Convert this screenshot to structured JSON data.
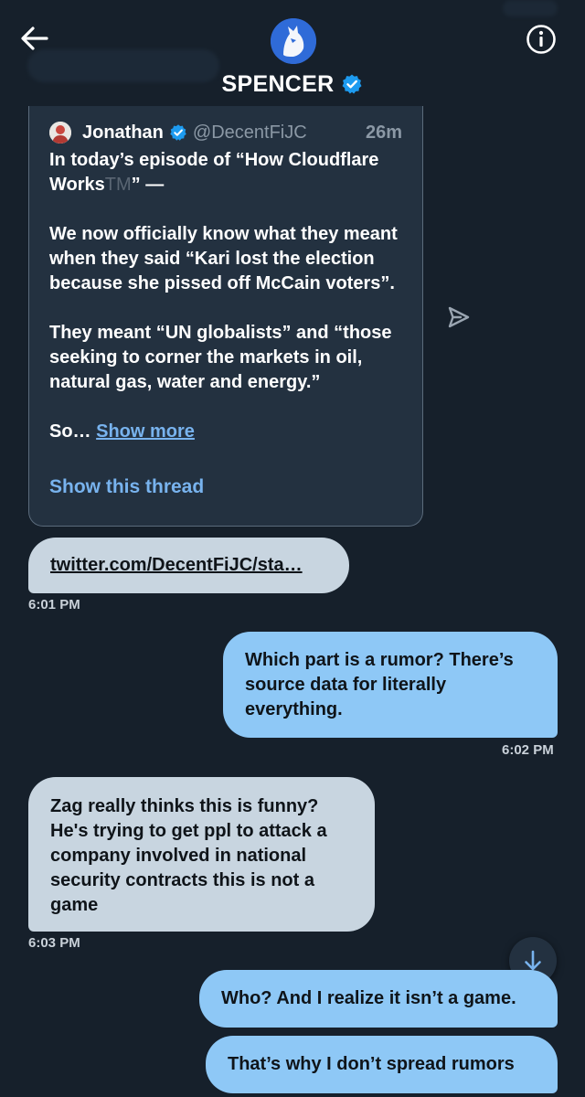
{
  "header": {
    "name": "SPENCER",
    "icons": {
      "back": "arrow-left-icon",
      "info": "info-icon",
      "verified": "verified-badge-icon"
    }
  },
  "quoted_post": {
    "author": "Jonathan",
    "handle": "@DecentFiJC",
    "time": "26m",
    "line1": "In today’s episode of “How Cloudflare Works",
    "tm": "TM",
    "line1_end": "” —",
    "para2": "We now officially know what they meant when they said “Kari lost the election because she pissed off McCain voters”.",
    "para3": "They meant “UN globalists” and “those seeking to corner the markets in oil, natural gas, water and energy.”",
    "para4_prefix": "So… ",
    "show_more": "Show more",
    "show_thread": "Show this thread"
  },
  "messages": [
    {
      "direction": "in",
      "text": "twitter.com/DecentFiJC/sta…",
      "time": "6:01 PM"
    },
    {
      "direction": "out",
      "text": "Which part is a rumor? There’s source data for literally everything.",
      "time": "6:02 PM"
    },
    {
      "direction": "in",
      "text": "Zag really thinks this is funny? He's trying to get ppl to attack a company involved in national security contracts this is not a game",
      "time": "6:03 PM"
    },
    {
      "direction": "out",
      "text": "Who? And I realize it isn’t a game."
    },
    {
      "direction": "out",
      "text": "That’s why I don’t spread rumors"
    }
  ],
  "colors": {
    "background": "#16202b",
    "incoming_bubble": "#c8d5e0",
    "outgoing_bubble": "#8ec8f6",
    "link": "#78b3ee",
    "verified": "#1d9bf0"
  }
}
